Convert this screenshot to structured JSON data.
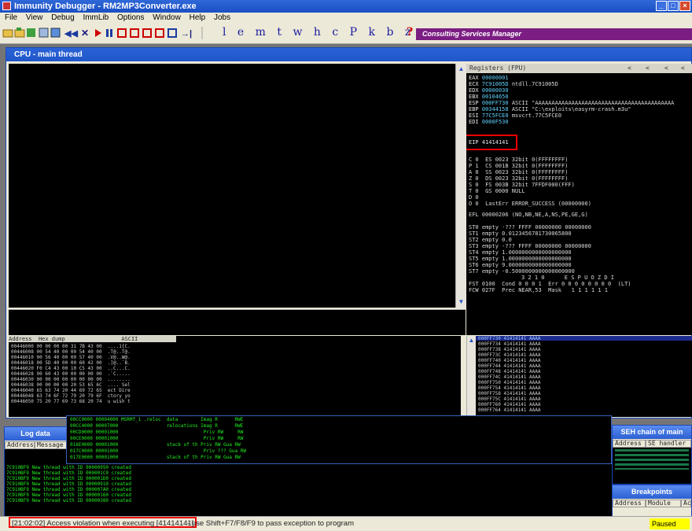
{
  "window": {
    "title": "Immunity Debugger - RM2MP3Converter.exe"
  },
  "menu": [
    "File",
    "View",
    "Debug",
    "ImmLib",
    "Options",
    "Window",
    "Help",
    "Jobs"
  ],
  "toolbar": {
    "letter_buttons": "l e m t w h c P k b z r ... s",
    "help_glyph": "?",
    "consulting_label": "Consulting Services Manager"
  },
  "cpu": {
    "title": "CPU - main thread",
    "registers_header": "Registers (FPU)",
    "registers": [
      {
        "name": "EAX",
        "value": "00000001",
        "comment": ""
      },
      {
        "name": "ECX",
        "value": "7C91005D",
        "comment": "ntdll.7C91005D"
      },
      {
        "name": "EDX",
        "value": "00000030",
        "comment": ""
      },
      {
        "name": "EBX",
        "value": "00104650",
        "comment": ""
      },
      {
        "name": "ESP",
        "value": "000FF730",
        "comment": "ASCII \"AAAAAAAAAAAAAAAAAAAAAAAAAAAAAAAAAAAAAAAAAA"
      },
      {
        "name": "EBP",
        "value": "00344158",
        "comment": "ASCII \"C:\\exploits\\easyrm-crash.m3u\""
      },
      {
        "name": "ESI",
        "value": "77C5FCE0",
        "comment": "msvcrt.77C5FCE0"
      },
      {
        "name": "EDI",
        "value": "0000F530",
        "comment": ""
      },
      {
        "name": "EIP",
        "value": "41414141",
        "comment": ""
      }
    ],
    "flags": [
      "C 0  ES 0023 32bit 0(FFFFFFFF)",
      "P 1  CS 001B 32bit 0(FFFFFFFF)",
      "A 0  SS 0023 32bit 0(FFFFFFFF)",
      "Z 0  DS 0023 32bit 0(FFFFFFFF)",
      "S 0  FS 003B 32bit 7FFDF000(FFF)",
      "T 0  GS 0000 NULL",
      "D 0",
      "O 0  LastErr ERROR_SUCCESS (00000000)"
    ],
    "efl": "EFL 00000206 (NO,NB,NE,A,NS,PE,GE,G)",
    "fpu": [
      "ST0 empty -??? FFFF 00000000 00000000",
      "ST1 empty 0.0123456781730065800",
      "ST2 empty 0.0",
      "ST3 empty -??? FFFF 00000000 00000000",
      "ST4 empty 1.0000000000000000000",
      "ST5 empty 1.0000000000000000000",
      "ST6 empty 9.0000000000000000000",
      "ST7 empty -0.5000000000000000000"
    ],
    "fst_bits": "3 2 1 0      E S P U O Z D I",
    "fst": "FST 0100  Cond 0 0 0 1  Err 0 0 0 0 0 0 0 0  (LT)",
    "fcw": "FCW 027F  Prec NEAR,53  Mask   1 1 1 1 1 1"
  },
  "dump": {
    "headers": [
      "Address",
      "Hex dump",
      "ASCII"
    ],
    "rows": [
      "00446000 00 00 00 00 31 7B 43 00  ....1{C.",
      "00446008 00 54 40 00 00 54 40 00  .T@..T@.",
      "00446010 00 56 40 00 00 57 40 00  .V@..W@.",
      "00446018 00 5D 40 00 00 60 42 00  .]@..`B.",
      "00446020 F0 C4 43 00 10 C5 43 00  ..C...C.",
      "00446028 90 60 43 00 00 00 00 00  .`C.....",
      "00446030 00 00 00 00 00 00 00 00  ........",
      "00446038 00 00 00 00 20 53 65 6C  .... Sel",
      "00446040 65 63 74 20 44 69 72 65  ect Dire",
      "00446048 63 74 6F 72 79 20 79 6F  ctory yo",
      "00446050 75 20 77 69 73 68 20 74  u wish t"
    ]
  },
  "stack": {
    "rows": [
      "000FF730 41414141 AAAA",
      "000FF734 41414141 AAAA",
      "000FF738 41414141 AAAA",
      "000FF73C 41414141 AAAA",
      "000FF740 41414141 AAAA",
      "000FF744 41414141 AAAA",
      "000FF748 41414141 AAAA",
      "000FF74C 41414141 AAAA",
      "000FF750 41414141 AAAA",
      "000FF754 41414141 AAAA",
      "000FF758 41414141 AAAA",
      "000FF75C 41414141 AAAA",
      "000FF760 41414141 AAAA",
      "000FF764 41414141 AAAA"
    ]
  },
  "memory": {
    "rows": [
      "00CC0000 00004000 MSRMf_1 .reloc  data        Imag R      RWE",
      "00CC4000 00007000                 relocations Imag R      RWE",
      "00CD0000 00001000                              Priv RW     RW",
      "00CE0000 00001000                              Priv RW     RW",
      "016E0000 00001000                 stack of th Priv RW Gua RW",
      "017C0000 00001000                              Priv ??? Gua RW",
      "017E0000 00001000                 stack of th Priv RW Gua RW"
    ]
  },
  "log": {
    "title": "Log data",
    "headers": [
      "Address",
      "Message"
    ],
    "rows": [
      "7C910BF9 New thread with ID 00000950 created",
      "7C910BF9 New thread with ID 000001C0 created",
      "7C910BF9 New thread with ID 000001D0 created",
      "7C910BF9 New thread with ID 00000910 created",
      "7C910BF9 New thread with ID 000007A0 created",
      "7C910BF9 New thread with ID 00000160 created",
      "7C910BF9 New thread with ID 00000380 created"
    ]
  },
  "seh": {
    "title": "SEH chain of main",
    "headers": [
      "Address",
      "SE handler"
    ]
  },
  "breakpoints": {
    "title": "Breakpoints",
    "headers": [
      "Address",
      "Module",
      "Ac"
    ]
  },
  "status": {
    "message": "[21:02:02] Access violation when executing [41414141]",
    "hint": "- use Shift+F7/F8/F9 to pass exception to program",
    "state": "Paused"
  }
}
